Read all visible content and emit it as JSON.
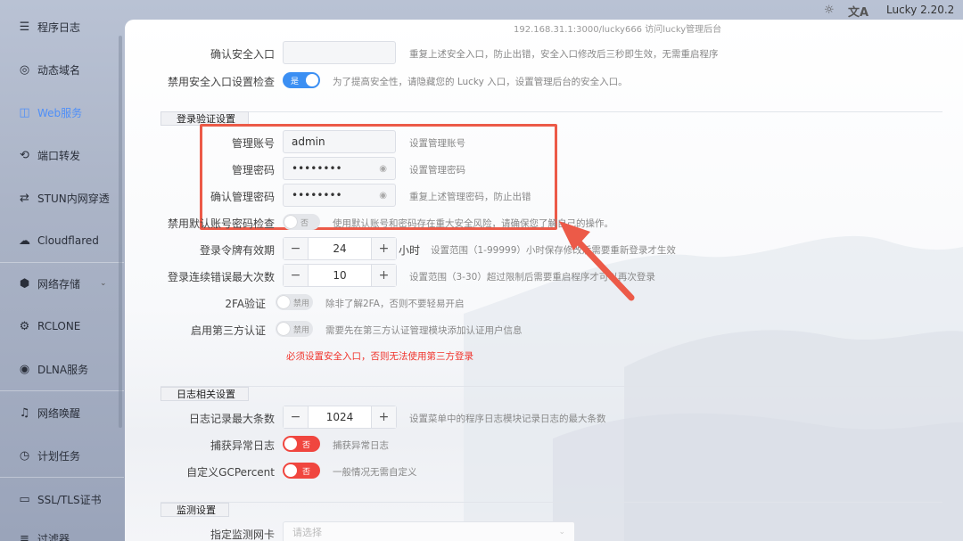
{
  "topbar": {
    "access_url": "192.168.31.1:3000/lucky666 访问lucky管理后台",
    "sun_icon": "☼",
    "lang_icon": "文A",
    "version": "Lucky 2.20.2"
  },
  "sidebar": {
    "items": [
      {
        "label": "程序日志",
        "icon": "log-icon",
        "glyph": "☰"
      },
      {
        "label": "动态域名",
        "icon": "globe-icon",
        "glyph": "◎"
      },
      {
        "label": "Web服务",
        "icon": "web-icon",
        "glyph": "◫",
        "active": true
      },
      {
        "label": "端口转发",
        "icon": "forward-icon",
        "glyph": "⟲"
      },
      {
        "label": "STUN内网穿透",
        "icon": "stun-icon",
        "glyph": "⇄"
      },
      {
        "label": "Cloudflared",
        "icon": "cloud-icon",
        "glyph": "☁"
      },
      {
        "label": "网络存储",
        "icon": "storage-icon",
        "glyph": "⬢"
      },
      {
        "label": "RCLONE",
        "icon": "rclone-icon",
        "glyph": "⚙"
      },
      {
        "label": "DLNA服务",
        "icon": "dlna-icon",
        "glyph": "◉"
      },
      {
        "label": "网络唤醒",
        "icon": "bell-icon",
        "glyph": "♫"
      },
      {
        "label": "计划任务",
        "icon": "clock-icon",
        "glyph": "◷"
      },
      {
        "label": "SSL/TLS证书",
        "icon": "certificate-icon",
        "glyph": "▭"
      },
      {
        "label": "过滤器",
        "icon": "filter-icon",
        "glyph": "≡"
      }
    ],
    "chevron": "⌄"
  },
  "security": {
    "confirm_entry_label": "确认安全入口",
    "confirm_entry_value": "",
    "confirm_entry_hint": "重复上述安全入口，防止出错，安全入口修改后三秒即生效，无需重启程序",
    "disable_check_label": "禁用安全入口设置检查",
    "disable_check_toggle": "是",
    "disable_check_hint": "为了提高安全性，请隐藏您的 Lucky 入口，设置管理后台的安全入口。"
  },
  "login": {
    "section_title": "登录验证设置",
    "account_label": "管理账号",
    "account_value": "admin",
    "account_hint": "设置管理账号",
    "password_label": "管理密码",
    "password_value": "••••••••",
    "password_hint": "设置管理密码",
    "confirm_password_label": "确认管理密码",
    "confirm_password_value": "••••••••",
    "confirm_password_hint": "重复上述管理密码，防止出错",
    "eye_icon": "◉",
    "disable_default_label": "禁用默认账号密码检查",
    "disable_default_toggle": "否",
    "disable_default_hint": "使用默认账号和密码存在重大安全风险，请确保您了解自己的操作。",
    "token_label": "登录令牌有效期",
    "token_value": "24",
    "token_unit": "小时",
    "token_hint": "设置范围（1-99999）小时保存修改后需要重新登录才生效",
    "max_errors_label": "登录连续错误最大次数",
    "max_errors_value": "10",
    "max_errors_hint": "设置范围（3-30）超过限制后需要重启程序才可以再次登录",
    "twofa_label": "2FA验证",
    "twofa_toggle": "禁用",
    "twofa_hint": "除非了解2FA，否则不要轻易开启",
    "third_party_label": "启用第三方认证",
    "third_party_toggle": "禁用",
    "third_party_hint": "需要先在第三方认证管理模块添加认证用户信息",
    "warning": "必须设置安全入口，否则无法使用第三方登录",
    "minus": "−",
    "plus": "+"
  },
  "logs": {
    "section_title": "日志相关设置",
    "max_entries_label": "日志记录最大条数",
    "max_entries_value": "1024",
    "max_entries_hint": "设置菜单中的程序日志模块记录日志的最大条数",
    "catch_label": "捕获异常日志",
    "catch_toggle": "否",
    "catch_hint": "捕获异常日志",
    "gc_label": "自定义GCPercent",
    "gc_toggle": "否",
    "gc_hint": "一般情况无需自定义"
  },
  "monitor": {
    "section_title": "监测设置",
    "nic_label": "指定监测网卡",
    "nic_placeholder": "请选择"
  },
  "colors": {
    "accent": "#3b8ff3",
    "danger": "#f0463f",
    "annotation": "#ec5a48"
  }
}
